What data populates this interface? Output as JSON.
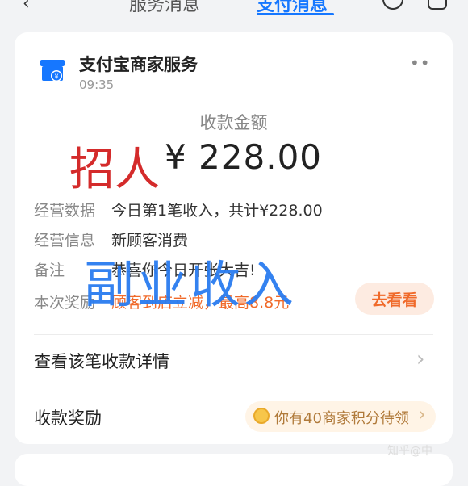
{
  "nav": {
    "tab_service": "服务消息",
    "tab_pay": "支付消息"
  },
  "header": {
    "app_name": "支付宝商家服务",
    "time": "09:35"
  },
  "amount": {
    "label": "收款金额",
    "value": "¥ 228.00"
  },
  "overlays": {
    "recruit": "招人",
    "side_income": "副业收入"
  },
  "rows": [
    {
      "label": "经营数据",
      "value": "今日第1笔收入，共计¥228.00"
    },
    {
      "label": "经营信息",
      "value": "新顾客消费"
    },
    {
      "label": "备注",
      "value": "恭喜你今日开张大吉!"
    },
    {
      "label": "本次奖励",
      "value": "顾客到店立减，最高8.8元"
    }
  ],
  "buttons": {
    "look": "去看看"
  },
  "links": {
    "details": "查看该笔收款详情",
    "reward": "收款奖励"
  },
  "reward_pill": {
    "text": "你有40商家积分待领"
  },
  "watermark": "知乎@中"
}
